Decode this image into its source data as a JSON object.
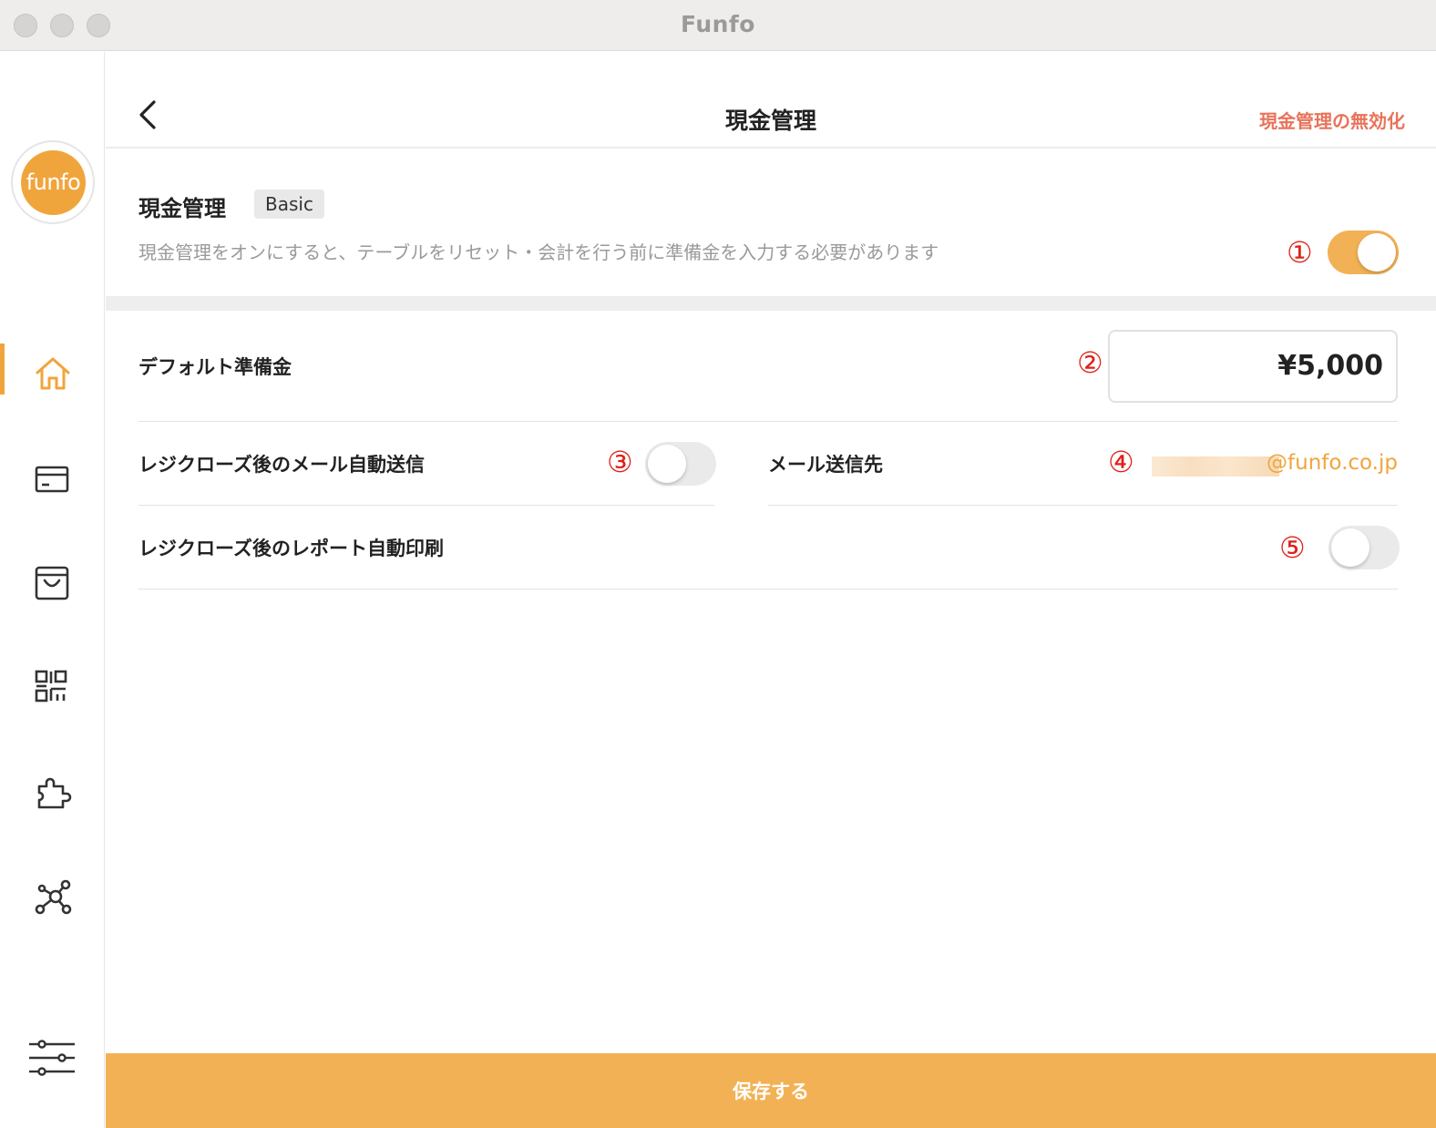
{
  "window": {
    "title": "Funfo"
  },
  "sidebar": {
    "logo_text": "funfo",
    "items": [
      {
        "icon": "home-icon",
        "active": true
      },
      {
        "icon": "card-icon",
        "active": false
      },
      {
        "icon": "shopping-bag-icon",
        "active": false
      },
      {
        "icon": "qr-code-icon",
        "active": false
      },
      {
        "icon": "puzzle-icon",
        "active": false
      },
      {
        "icon": "network-icon",
        "active": false
      },
      {
        "icon": "sliders-icon",
        "active": false
      }
    ]
  },
  "header": {
    "back_icon": "chevron-left-icon",
    "title": "現金管理",
    "disable_link": "現金管理の無効化"
  },
  "cash_management": {
    "title": "現金管理",
    "badge": "Basic",
    "description": "現金管理をオンにすると、テーブルをリセット・会計を行う前に準備金を入力する必要があります",
    "enabled": true,
    "marker": "①"
  },
  "default_reserve": {
    "label": "デフォルト準備金",
    "value": "¥5,000",
    "marker": "②"
  },
  "auto_email": {
    "label": "レジクローズ後のメール自動送信",
    "enabled": false,
    "marker": "③"
  },
  "email_destination": {
    "label": "メール送信先",
    "value_visible": "@funfo.co.jp",
    "marker": "④"
  },
  "auto_print": {
    "label": "レジクローズ後のレポート自動印刷",
    "enabled": false,
    "marker": "⑤"
  },
  "footer": {
    "save_label": "保存する"
  },
  "colors": {
    "accent": "#f0a53c",
    "toggle_on": "#f2b155",
    "danger_link": "#e8735a",
    "marker": "#e0201a"
  }
}
